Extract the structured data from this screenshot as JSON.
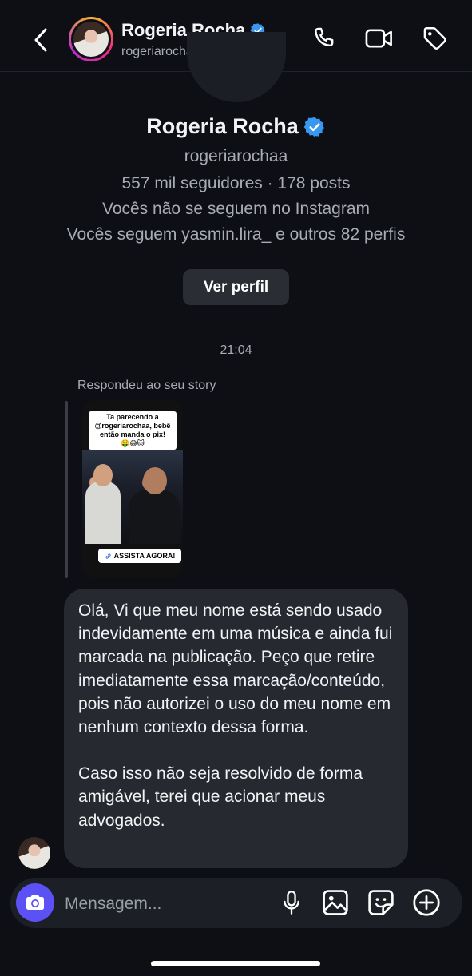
{
  "header": {
    "name": "Rogeria Rocha",
    "username": "rogeriarochaa"
  },
  "profile": {
    "name": "Rogeria Rocha",
    "username": "rogeriarochaa",
    "stats": "557 mil seguidores · 178 posts",
    "follow_status": "Vocês não se seguem no Instagram",
    "mutuals": "Vocês seguem yasmin.lira_ e outros 82 perfis",
    "view_profile_label": "Ver perfil"
  },
  "chat": {
    "timestamp": "21:04",
    "reply_label": "Respondeu ao seu story",
    "story": {
      "caption": "Ta parecendo a @rogeriarochaa, bebê então manda o pix!",
      "emojis": "🤑😅🐱",
      "cta": "ASSISTA AGORA!"
    },
    "message_paragraphs": [
      "Olá, Vi que meu nome está sendo usado indevidamente em uma música e ainda fui marcada na publicação. Peço que retire imediatamente essa marcação/conteúdo, pois não autorizei o uso do meu nome em nenhum contexto dessa forma.",
      "Caso isso não seja resolvido de forma amigável, terei que acionar meus advogados."
    ]
  },
  "composer": {
    "placeholder": "Mensagem..."
  },
  "icons": {
    "back": "chevron-left-icon",
    "call": "phone-icon",
    "video": "video-camera-icon",
    "tag": "tag-icon",
    "camera": "camera-icon",
    "mic": "microphone-icon",
    "gallery": "image-icon",
    "sticker": "sticker-icon",
    "add": "plus-circle-icon"
  },
  "colors": {
    "background": "#0d0f14",
    "bubble": "#26292f",
    "camera_button": "#5b51f5",
    "verified": "#3897f0"
  }
}
